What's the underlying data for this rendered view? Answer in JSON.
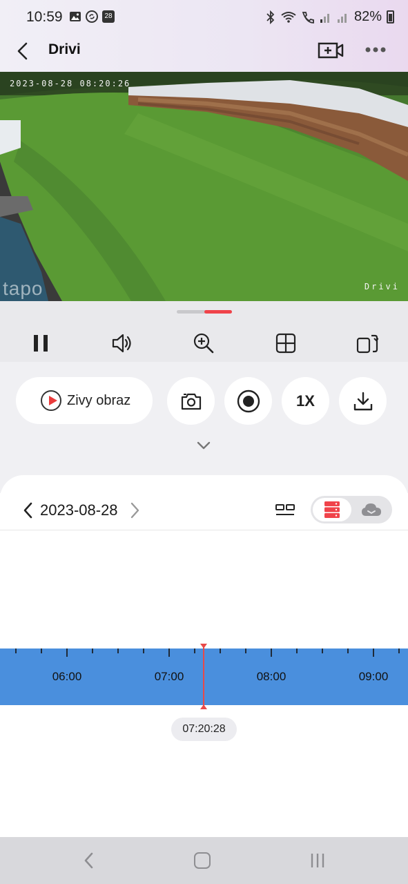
{
  "status_bar": {
    "time": "10:59",
    "calendar_day": "28",
    "battery": "82%"
  },
  "header": {
    "title": "Drivi",
    "back_icon": "arrow-left-icon",
    "add_camera_icon": "video-plus-icon",
    "more_icon": "more-dots-icon"
  },
  "video": {
    "timestamp_overlay": "2023-08-28 08:20:26",
    "camera_name_overlay": "Drivi",
    "watermark": "tapo"
  },
  "toolbar": {
    "icons": [
      "pause-icon",
      "volume-icon",
      "zoom-in-icon",
      "grid-icon",
      "screens-icon"
    ]
  },
  "actions": {
    "live_label": "Zivy obraz",
    "speed_label": "1X",
    "icons": [
      "camera-icon",
      "record-icon",
      "download-icon"
    ]
  },
  "timeline": {
    "date": "2023-08-28",
    "hour_labels": [
      "06:00",
      "07:00",
      "08:00",
      "09:00"
    ],
    "current_time": "07:20:28",
    "source_selected": "sd-card",
    "accent": "#4a8fdd",
    "cursor_color": "#e84a4a"
  },
  "colors": {
    "brand_red": "#f0434a"
  }
}
